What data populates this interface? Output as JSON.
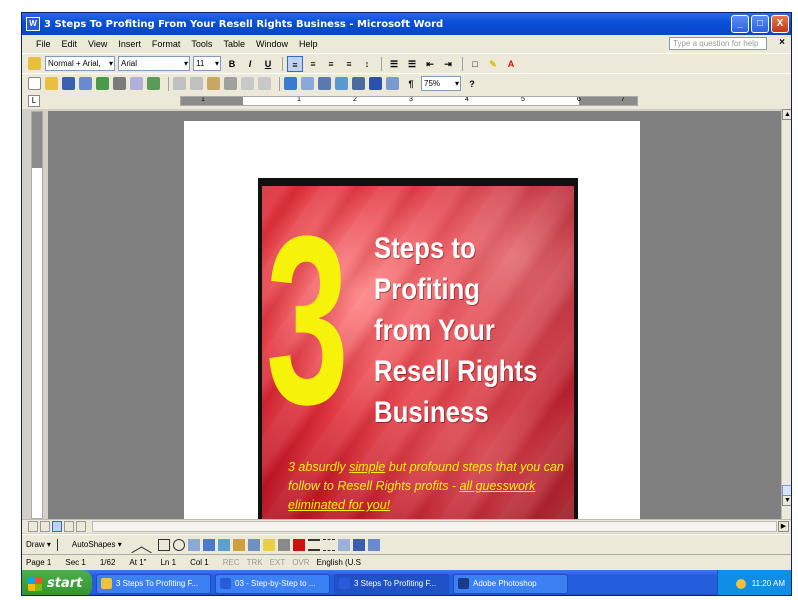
{
  "window": {
    "title": "3 Steps To Profiting From Your Resell Rights Business - Microsoft Word",
    "minimize": "_",
    "maximize": "□",
    "close": "X"
  },
  "menu": {
    "items": [
      "File",
      "Edit",
      "View",
      "Insert",
      "Format",
      "Tools",
      "Table",
      "Window",
      "Help"
    ],
    "help_placeholder": "Type a question for help",
    "close_doc": "×"
  },
  "formatting": {
    "style": "Normal + Arial,",
    "font": "Arial",
    "size": "11",
    "bold": "B",
    "italic": "I",
    "underline": "U"
  },
  "standard": {
    "zoom": "75%",
    "paragraph_mark": "¶",
    "help_icon": "?"
  },
  "ruler": {
    "corner": "L",
    "numbers": [
      "1",
      "1",
      "2",
      "3",
      "4",
      "5",
      "6",
      "7"
    ]
  },
  "cover": {
    "number": "3",
    "title_lines": [
      "Steps to",
      "Profiting",
      "from Your",
      "Resell Rights",
      "Business"
    ],
    "subtitle_part1": "3 absurdly ",
    "subtitle_emph": "simple",
    "subtitle_part2": " but profound steps that you can follow to Resell Rights profits - ",
    "subtitle_underlined": "all guesswork eliminated for you!",
    "colors": {
      "background": "#b01020",
      "number": "#f6f20a",
      "title": "#ffffff",
      "subtitle": "#f6f20a"
    }
  },
  "drawing": {
    "draw": "Draw ▾",
    "autoshapes": "AutoShapes ▾"
  },
  "status": {
    "page": "Page 1",
    "section": "Sec 1",
    "pages": "1/62",
    "at": "At 1\"",
    "line": "Ln 1",
    "col": "Col 1",
    "rec": "REC",
    "trk": "TRK",
    "ext": "EXT",
    "ovr": "OVR",
    "language": "English (U.S"
  },
  "taskbar": {
    "start": "start",
    "items": [
      "3 Steps To Profiting F...",
      "03 - Step-by-Step to ...",
      "3 Steps To Profiting F...",
      "Adobe Photoshop"
    ],
    "clock": "11:20 AM"
  }
}
